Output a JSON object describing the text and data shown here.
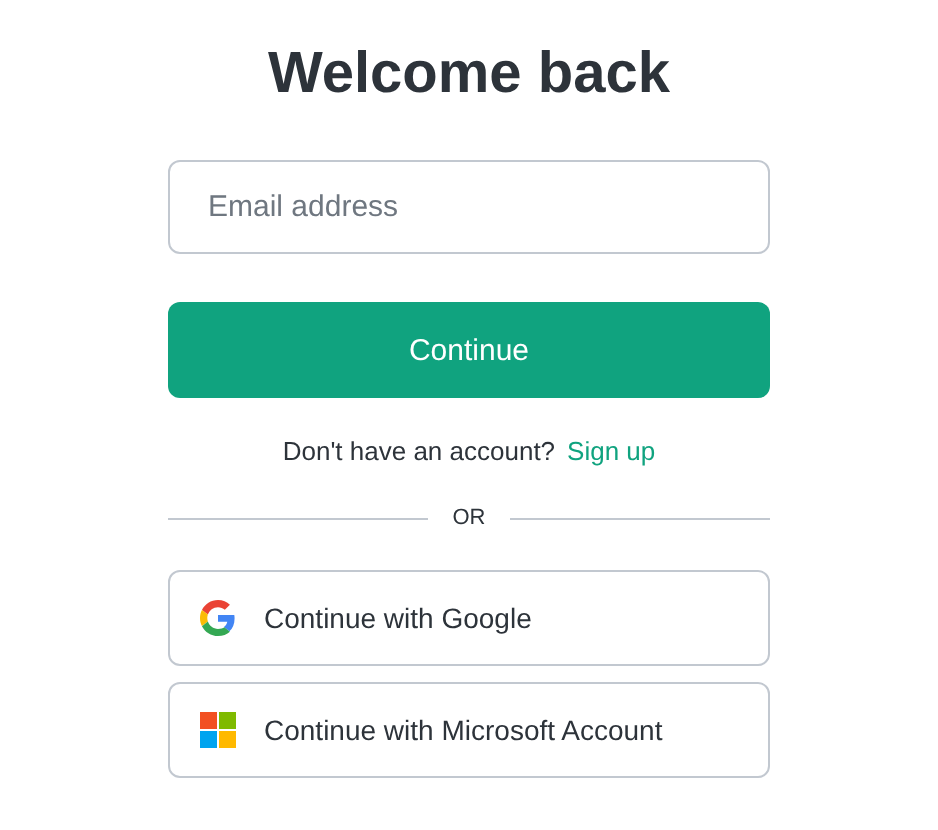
{
  "title": "Welcome back",
  "email_field": {
    "placeholder": "Email address"
  },
  "continue_button": "Continue",
  "signup_prompt": {
    "text": "Don't have an account?",
    "link": "Sign up"
  },
  "divider": "OR",
  "providers": [
    {
      "kind": "google",
      "label": "Continue with Google"
    },
    {
      "kind": "microsoft",
      "label": "Continue with Microsoft Account"
    }
  ]
}
